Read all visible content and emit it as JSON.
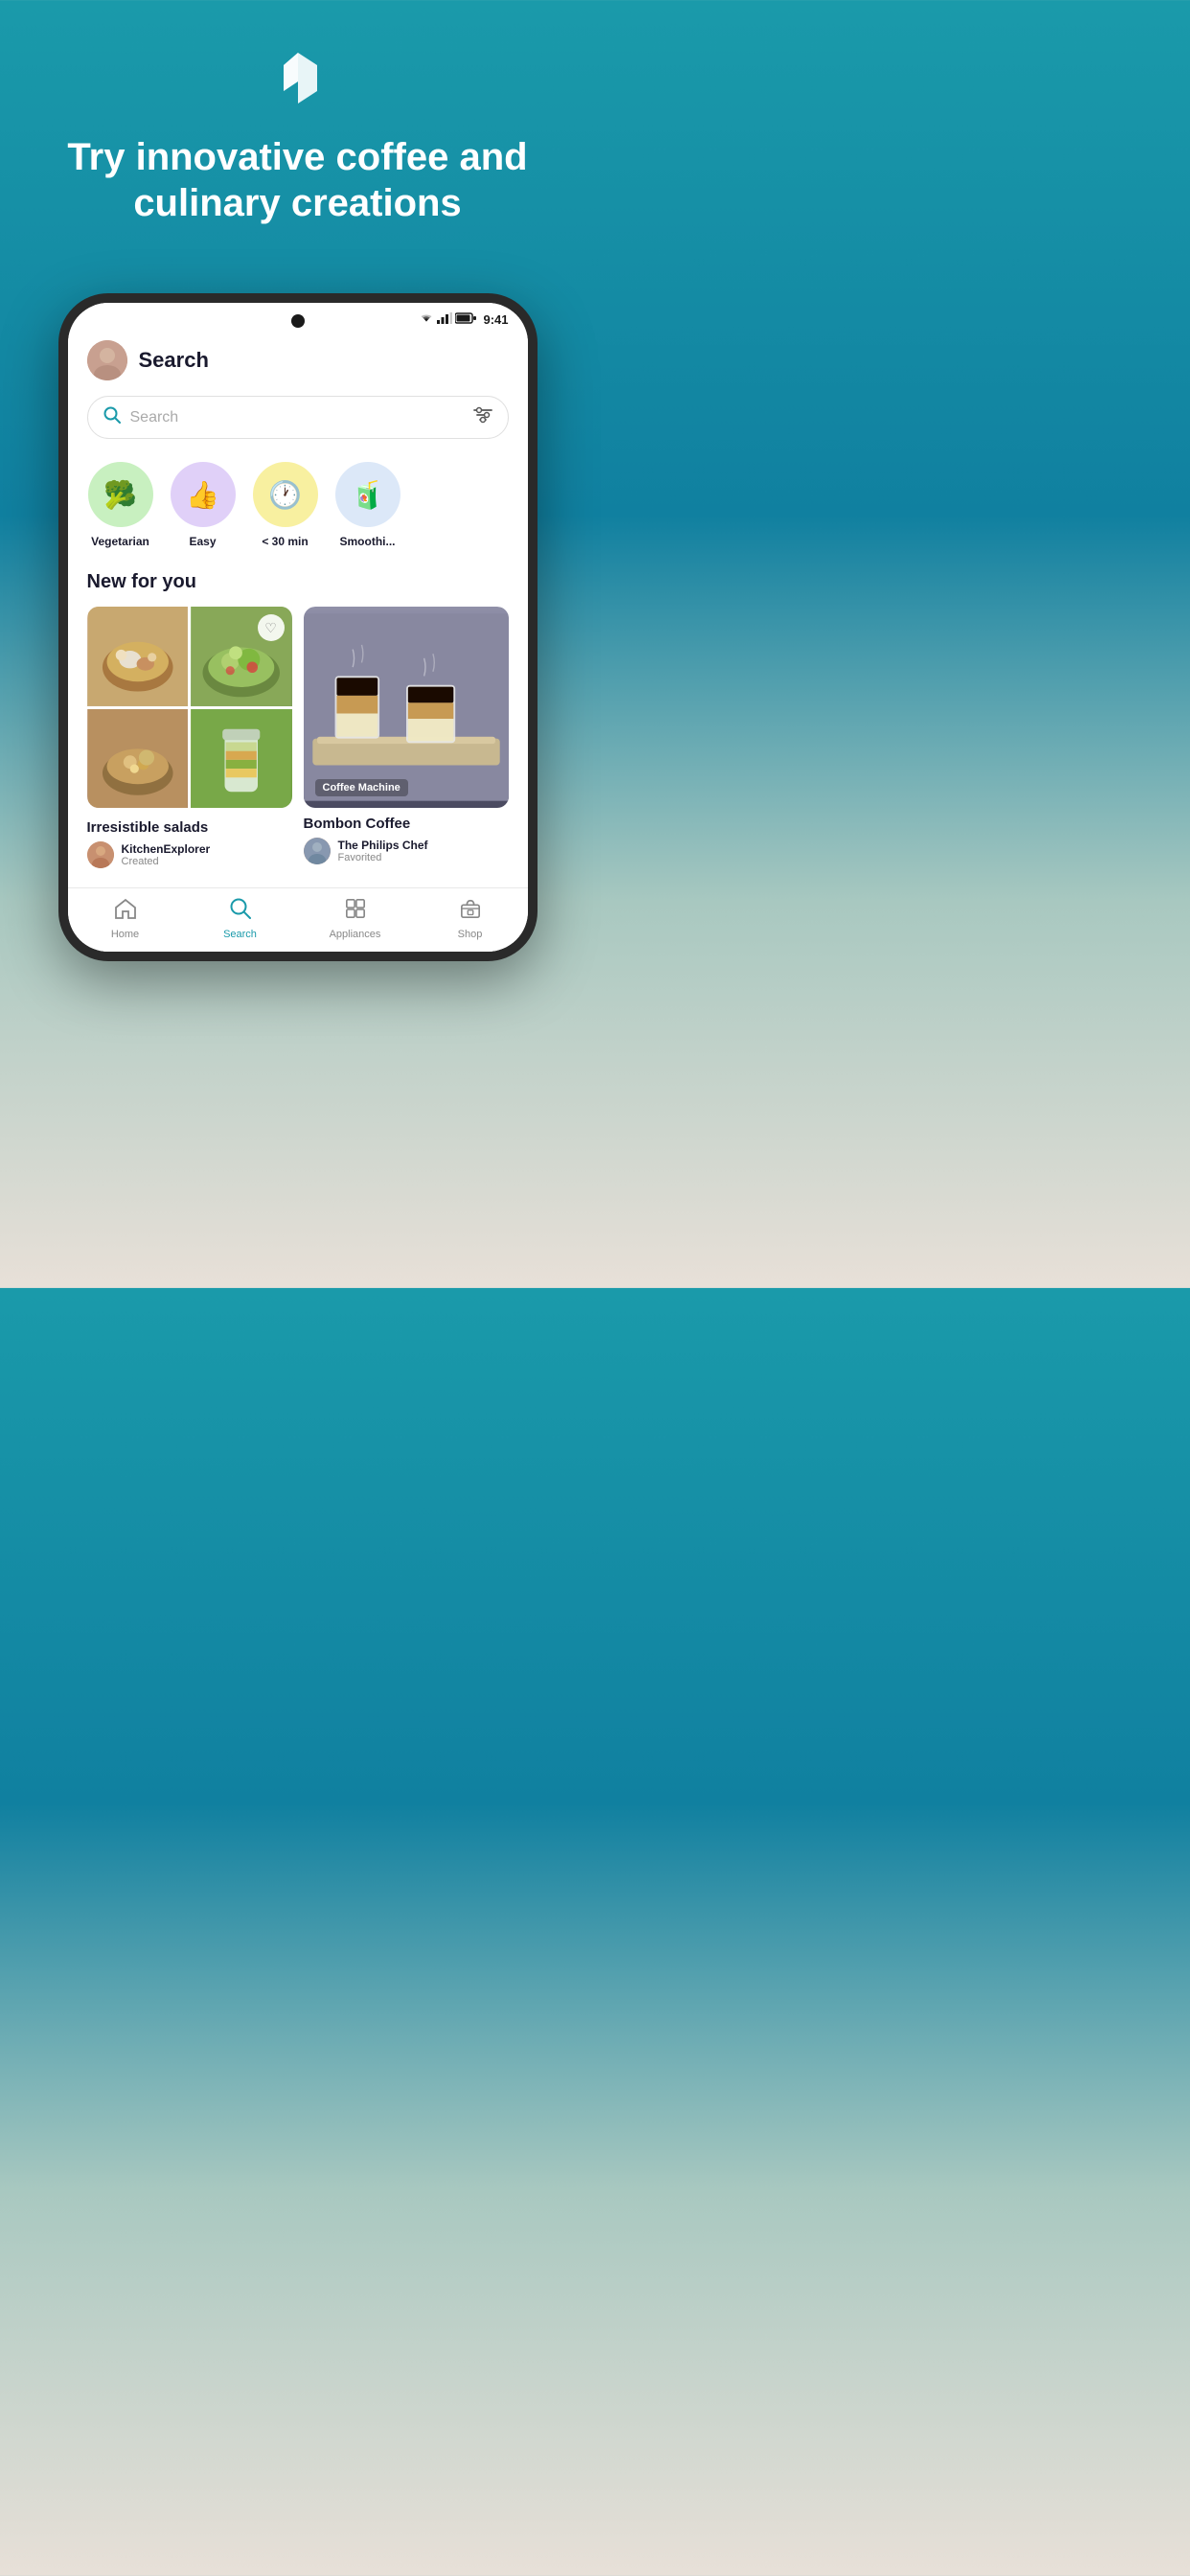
{
  "hero": {
    "title": "Try innovative coffee and culinary creations",
    "logo_alt": "Philips Kitchen app logo"
  },
  "status_bar": {
    "time": "9:41",
    "wifi": "wifi",
    "signal": "signal",
    "battery": "battery"
  },
  "header": {
    "page_title": "Search",
    "avatar_alt": "User avatar"
  },
  "search": {
    "placeholder": "Search",
    "filter_icon": "filter-icon"
  },
  "categories": [
    {
      "label": "Vegetarian",
      "icon": "🥦",
      "color": "green"
    },
    {
      "label": "Easy",
      "icon": "👍",
      "color": "purple"
    },
    {
      "label": "< 30 min",
      "icon": "🕐",
      "color": "yellow"
    },
    {
      "label": "Smoothi...",
      "icon": "🧃",
      "color": "blue"
    }
  ],
  "section": {
    "new_for_you": "New for you"
  },
  "cards": [
    {
      "id": "left-card",
      "title": "Irresistible salads",
      "author": "KitchenExplorer",
      "action": "Created",
      "badge": null
    },
    {
      "id": "right-card",
      "title": "Bombon Coffee",
      "author": "The Philips Chef",
      "action": "Favorited",
      "badge": "Coffee Machine"
    }
  ],
  "bottom_nav": [
    {
      "label": "Home",
      "icon": "home",
      "active": false
    },
    {
      "label": "Search",
      "icon": "search",
      "active": true
    },
    {
      "label": "Appliances",
      "icon": "appliances",
      "active": false
    },
    {
      "label": "Shop",
      "icon": "shop",
      "active": false
    }
  ]
}
